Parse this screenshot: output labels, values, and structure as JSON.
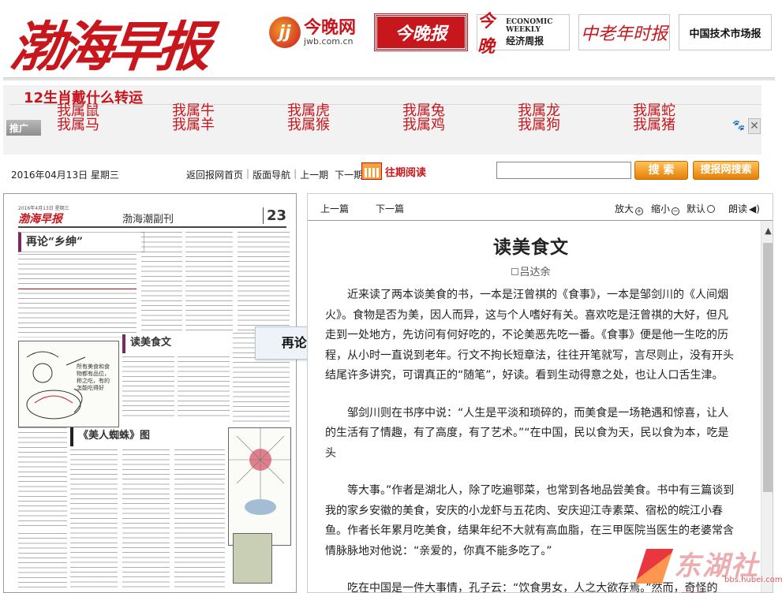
{
  "header": {
    "masthead": "渤海早报",
    "logos": {
      "jwb_mark": "jj",
      "jwb_name": "今晚网",
      "jwb_url": "jwb.com.cn",
      "jwbao": "今晚报",
      "jjzb_big": "今晚",
      "jjzb_en": "ECONOMIC WEEKLY",
      "jjzb_cn": "经济周报",
      "zlsb": "中老年时报",
      "zgjs": "中国技术市场报"
    }
  },
  "ad": {
    "tag": "推广",
    "title": "12生肖戴什么转运",
    "zodiac": [
      "我属鼠",
      "我属牛",
      "我属虎",
      "我属兔",
      "我属龙",
      "我属蛇",
      "我属马",
      "我属羊",
      "我属猴",
      "我属鸡",
      "我属狗",
      "我属猪"
    ],
    "close": "✕",
    "paw": "🐾"
  },
  "nav": {
    "date": "2016年04月13日  星期三",
    "links": [
      "返回报网首页",
      "版面导航",
      "上一期",
      "下一期"
    ],
    "archive": "往期阅读",
    "search_btn": "搜 索",
    "site_search_btn": "搜报网搜索"
  },
  "page_preview": {
    "date_line": "2016年4月13日 星期三",
    "logo": "渤海早报",
    "section": "渤海潮副刊",
    "page_number": "23",
    "headline_1": "再论“乡绅”",
    "headline_2": "读美食文",
    "headline_3": "《美人蜘蛛》图",
    "caption": "所有美食和食物都有品位，称之吃，有的怎能吃得好"
  },
  "tooltip": "再论“乡绅”",
  "article_toolbar": {
    "prev": "上一篇",
    "next": "下一篇",
    "zoom_in": "放大",
    "zoom_out": "缩小",
    "default": "默认",
    "read_aloud": "朗读"
  },
  "article": {
    "title": "读美食文",
    "author": "吕达余",
    "paragraphs": [
      "近来读了两本谈美食的书，一本是汪曾祺的《食事》，一本是邹剑川的《人间烟火》。食物是否为美，因人而异，这与个人嗜好有关。喜欢吃是汪曾祺的大好，但凡走到一处地方，先访问有何好吃的，不论美恶先吃一番。《食事》便是他一生吃的历程，从小时一直说到老年。行文不拘长短章法，往往开笔就写，言尽则止，没有开头结尾许多讲究，可谓真正的“随笔”，好读。看到生动得意之处，也让人口舌生津。",
      "邹剑川则在书序中说：“人生是平淡和琐碎的，而美食是一场艳遇和惊喜，让人的生活有了情趣，有了高度，有了艺术。”“在中国，民以食为天，民以食为本，吃是头",
      "等大事。”作者是湖北人，除了吃遍鄂菜，也常到各地品尝美食。书中有三篇谈到我的家乡安徽的美食，安庆的小龙虾与五花肉、安庆迎江寺素菜、宿松的皖江小春鱼。作者长年累月吃美食，结果年纪不大就有高血脂，在三甲医院当医生的老婆常含情脉脉地对他说：“亲爱的，你真不能多吃了。”",
      "吃在中国是一件大事情，孔子云：“饮食男女，人之大欲存焉。”然而，奇怪的是，过去国人关于吃的著述不多，文人写吃的文章也少。清代有个官僚文人叫袁枚"
    ]
  },
  "watermark": {
    "text": "东湖社区",
    "url": "bbs.hubei.com"
  }
}
